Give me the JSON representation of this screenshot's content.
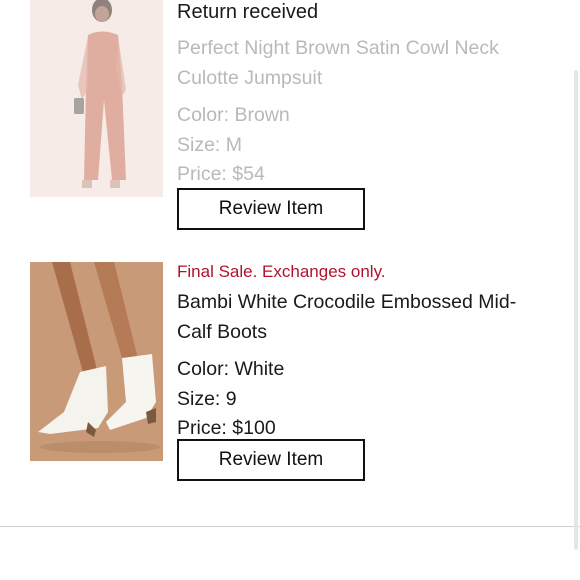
{
  "items": [
    {
      "status": "Return received",
      "name": "Perfect Night Brown Satin Cowl Neck Culotte Jumpsuit",
      "color_label": "Color:",
      "color": "Brown",
      "size_label": "Size:",
      "size": "M",
      "price_label": "Price:",
      "price": "$54",
      "button": "Review Item",
      "image_icon": "jumpsuit-photo"
    },
    {
      "notice": "Final Sale. Exchanges only.",
      "name": "Bambi White Crocodile Embossed Mid-Calf Boots",
      "color_label": "Color:",
      "color": "White",
      "size_label": "Size:",
      "size": "9",
      "price_label": "Price:",
      "price": "$100",
      "button": "Review Item",
      "image_icon": "boots-photo"
    }
  ],
  "colors": {
    "sale_red": "#b0122d",
    "faded_text": "#b9b9b9",
    "text": "#1a1a1a"
  }
}
